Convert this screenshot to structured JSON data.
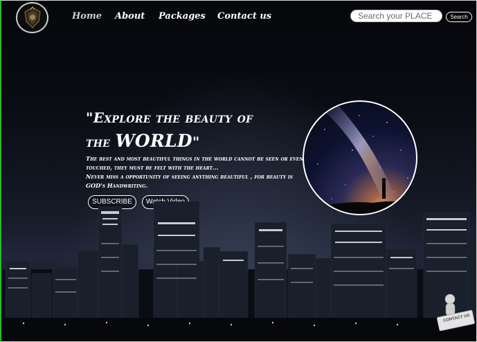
{
  "header": {
    "logo_icon": "shield-emblem-icon",
    "nav": [
      {
        "label": "Home",
        "active": true
      },
      {
        "label": "About"
      },
      {
        "label": "Packages"
      },
      {
        "label": "Contact us"
      }
    ],
    "search": {
      "placeholder": "Search your PLACE",
      "button_label": "Search"
    }
  },
  "hero": {
    "title_line1": "\"Explore the beauty of",
    "title_line2_prefix": "the ",
    "title_line2_big": "WORLD",
    "title_line2_suffix": "\"",
    "text_line1": "The best and most beautiful things in the world cannot be seen or even touched, they must be felt with the heart...",
    "text_line2": "Never miss a opportunity of seeing anything beautiful , for beauty is GOD's Handwriting.",
    "subscribe_label": "SUBSCRIBE",
    "watch_label": "Watch Video",
    "circle_image_icon": "milky-way-silhouette-icon"
  },
  "contact_widget": {
    "label": "CONTACT US",
    "icon": "figure-holding-sign-icon"
  },
  "colors": {
    "background": "#0a0c13",
    "text": "#ffffff",
    "page_edge": "#2eb82e"
  }
}
